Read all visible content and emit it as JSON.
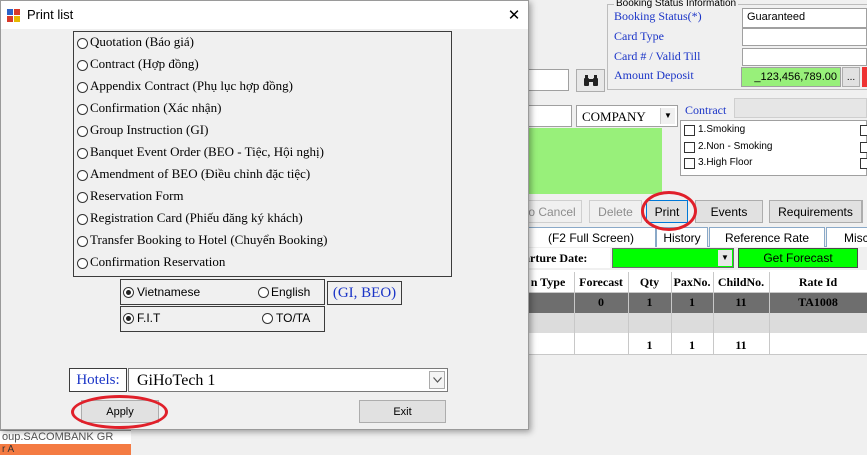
{
  "dialog": {
    "title": "Print list",
    "close_glyph": "✕",
    "report_options": [
      {
        "label": "Quotation (Báo giá)",
        "selected": false
      },
      {
        "label": "Contract (Hợp đồng)",
        "selected": false
      },
      {
        "label": "Appendix Contract (Phụ lục hợp đồng)",
        "selected": false
      },
      {
        "label": "Confirmation (Xác nhận)",
        "selected": false
      },
      {
        "label": "Group Instruction (GI)",
        "selected": false
      },
      {
        "label": "Banquet Event Order (BEO - Tiệc, Hội nghị)",
        "selected": false
      },
      {
        "label": "Amendment of BEO (Điều chỉnh đặc tiệc)",
        "selected": false
      },
      {
        "label": "Reservation Form",
        "selected": false
      },
      {
        "label": "Registration Card (Phiếu đăng ký khách)",
        "selected": false
      },
      {
        "label": "Transfer Booking to Hotel (Chuyển Booking)",
        "selected": false
      },
      {
        "label": "Confirmation Reservation",
        "selected": false
      }
    ],
    "language": {
      "vietnamese": "Vietnamese",
      "english": "English",
      "selected": "vietnamese"
    },
    "language_note": "(GI, BEO)",
    "type": {
      "fit": "F.I.T",
      "to_ta": "TO/TA",
      "selected": "fit"
    },
    "hotels_label": "Hotels:",
    "hotels_value": "GiHoTech 1",
    "apply_label": "Apply",
    "exit_label": "Exit"
  },
  "background": {
    "group_title": "Booking Status Information",
    "booking_status_label": "Booking Status(*)",
    "booking_status_value": "Guaranteed",
    "card_type_label": "Card Type",
    "card_valid_label": "Card # / Valid Till",
    "amount_deposit_label": "Amount Deposit",
    "amount_deposit_value": "_123,456,789.00",
    "ellipsis": "...",
    "company_value": "COMPANY",
    "contract_label": "Contract",
    "checkboxes": [
      "1.Smoking",
      "2.Non - Smoking",
      "3.High Floor"
    ],
    "buttons": {
      "cancel": "o Cancel",
      "delete": "Delete",
      "print": "Print",
      "events": "Events",
      "requirements": "Requirements"
    },
    "tabs": [
      "(F2 Full Screen)",
      "History",
      "Reference Rate",
      "Misc"
    ],
    "departure_label": "arture Date:",
    "get_forecast": "Get Forecast",
    "table": {
      "headers": [
        "n Type",
        "Forecast",
        "Qty",
        "PaxNo.",
        "ChildNo.",
        "Rate Id"
      ],
      "row1": [
        "",
        "0",
        "1",
        "1",
        "11",
        "TA1008"
      ],
      "totals": [
        "1",
        "1",
        "11"
      ]
    },
    "left_bottom_text": "oup.SACOMBANK GR",
    "left_bottom_text2": "r A"
  },
  "colors": {
    "accent_blue": "#1a34c7",
    "green_field": "#98f07a",
    "bright_green": "#00ff00",
    "highlight_ring": "#e0202a",
    "selected_row": "#6e6e6e"
  }
}
